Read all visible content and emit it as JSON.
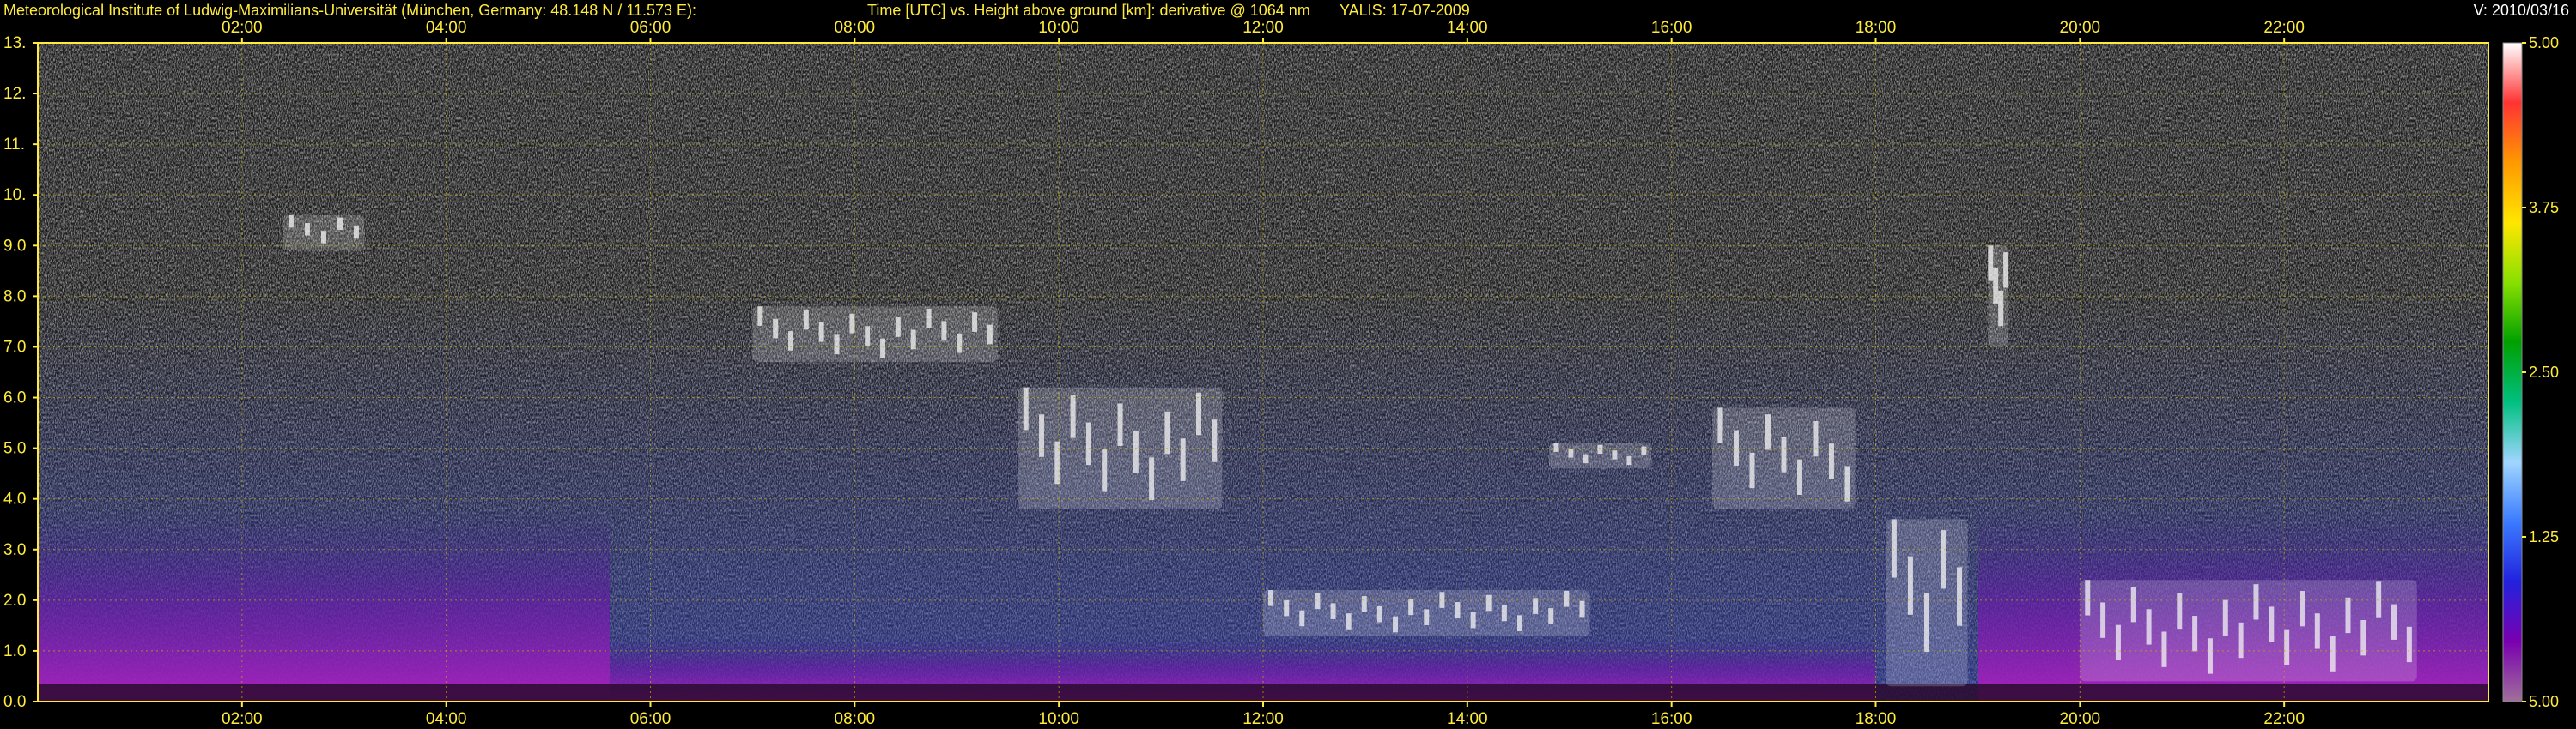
{
  "header": {
    "institute": "Meteorological Institute of Ludwig-Maximilians-Universität (München, Germany: 48.148 N / 11.573 E):",
    "description": "Time [UTC] vs. Height above ground [km]: derivative @ 1064 nm",
    "instrument_date": "YALIS: 17-07-2009",
    "version": "V: 2010/03/16"
  },
  "colors": {
    "background": "#000000",
    "frame": "#ffeb3b",
    "grid": "#bfb200",
    "label_text": "#ffeb3b"
  },
  "chart_data": {
    "type": "heatmap",
    "x_label": "Time [UTC]",
    "y_label": "Height above ground [km]",
    "x_unit": "hour UTC",
    "xlim": [
      0,
      24
    ],
    "ylim": [
      0.0,
      13.0
    ],
    "x_ticks": [
      2,
      4,
      6,
      8,
      10,
      12,
      14,
      16,
      18,
      20,
      22
    ],
    "x_tick_labels": [
      "02:00",
      "04:00",
      "06:00",
      "08:00",
      "10:00",
      "12:00",
      "14:00",
      "16:00",
      "18:00",
      "20:00",
      "22:00"
    ],
    "y_ticks": [
      0,
      1,
      2,
      3,
      4,
      5,
      6,
      7,
      8,
      9,
      10,
      11,
      12,
      13
    ],
    "y_tick_labels": [
      "0.0",
      "1.0",
      "2.0",
      "3.0",
      "4.0",
      "5.0",
      "6.0",
      "7.0",
      "8.0",
      "9.0",
      "10.",
      "11.",
      "12.",
      "13."
    ],
    "grid": true,
    "colorbar": {
      "ticks": [
        5.0,
        3.75,
        2.5,
        1.25,
        5.0
      ],
      "tick_labels": [
        "5.00",
        "3.75",
        "2.50",
        "1.25",
        "5.00"
      ],
      "stops": [
        "#ffffff",
        "#ff3333",
        "#ff9900",
        "#ffe600",
        "#88e000",
        "#00a000",
        "#00c080",
        "#9fd6ff",
        "#3b7bff",
        "#2222dd",
        "#7a00b0",
        "#a0709a"
      ]
    },
    "cloud_features": [
      {
        "start_hour": 2.4,
        "end_hour": 3.2,
        "base_km": 8.9,
        "top_km": 9.6
      },
      {
        "start_hour": 7.0,
        "end_hour": 9.4,
        "base_km": 6.7,
        "top_km": 7.8
      },
      {
        "start_hour": 9.6,
        "end_hour": 11.6,
        "base_km": 3.8,
        "top_km": 6.2
      },
      {
        "start_hour": 12.0,
        "end_hour": 15.2,
        "base_km": 1.3,
        "top_km": 2.2
      },
      {
        "start_hour": 14.8,
        "end_hour": 15.8,
        "base_km": 4.6,
        "top_km": 5.1
      },
      {
        "start_hour": 16.4,
        "end_hour": 17.8,
        "base_km": 3.8,
        "top_km": 5.8
      },
      {
        "start_hour": 18.1,
        "end_hour": 18.9,
        "base_km": 0.3,
        "top_km": 3.6
      },
      {
        "start_hour": 19.1,
        "end_hour": 19.3,
        "base_km": 7.0,
        "top_km": 9.0
      },
      {
        "start_hour": 20.0,
        "end_hour": 23.3,
        "base_km": 0.4,
        "top_km": 2.4
      }
    ],
    "boundary_layer": [
      {
        "start_hour": 0.0,
        "end_hour": 5.6,
        "top_km": 3.8
      },
      {
        "start_hour": 5.6,
        "end_hour": 18.0,
        "top_km": 1.3
      },
      {
        "start_hour": 19.0,
        "end_hour": 24.0,
        "top_km": 3.8
      }
    ]
  }
}
